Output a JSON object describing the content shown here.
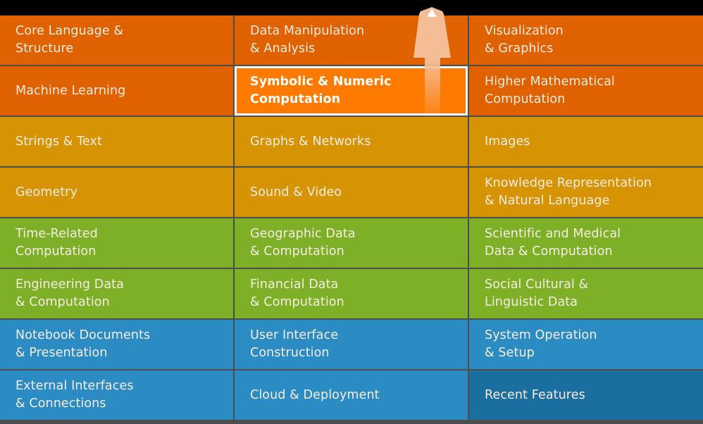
{
  "window": {
    "background_color": "#000000",
    "topbar_color": "#000000"
  },
  "palette": {
    "orange": "#df6100",
    "highlight_orange": "#ff7a00",
    "gold": "#d69405",
    "green": "#7db026",
    "blue": "#2b8cc4",
    "dark_blue": "#1b6ea0",
    "divider": "#4d4d4d",
    "label_text": "#f7ece3",
    "selected_text": "#ffffff",
    "selected_border": "#ffffff",
    "arrow": "#f5bd96"
  },
  "pointer": {
    "icon": "up-arrow-icon",
    "points_to": "Symbolic & Numeric Computation",
    "color": "#f5bd96"
  },
  "grid": {
    "columns": 3,
    "rows": 8,
    "cells": [
      {
        "label": "Core Language &\nStructure",
        "color": "orange",
        "selected": false
      },
      {
        "label": "Data Manipulation\n& Analysis",
        "color": "orange",
        "selected": false
      },
      {
        "label": "Visualization\n& Graphics",
        "color": "orange",
        "selected": false
      },
      {
        "label": "Machine Learning",
        "color": "orange",
        "selected": false
      },
      {
        "label": "Symbolic & Numeric\nComputation",
        "color": "orange",
        "selected": true
      },
      {
        "label": "Higher Mathematical\nComputation",
        "color": "orange",
        "selected": false
      },
      {
        "label": "Strings & Text",
        "color": "gold",
        "selected": false
      },
      {
        "label": "Graphs & Networks",
        "color": "gold",
        "selected": false
      },
      {
        "label": "Images",
        "color": "gold",
        "selected": false
      },
      {
        "label": "Geometry",
        "color": "gold",
        "selected": false
      },
      {
        "label": "Sound & Video",
        "color": "gold",
        "selected": false
      },
      {
        "label": "Knowledge Representation\n& Natural Language",
        "color": "gold",
        "selected": false
      },
      {
        "label": "Time-Related\nComputation",
        "color": "green",
        "selected": false
      },
      {
        "label": "Geographic Data\n& Computation",
        "color": "green",
        "selected": false
      },
      {
        "label": "Scientific and Medical\nData & Computation",
        "color": "green",
        "selected": false
      },
      {
        "label": "Engineering Data\n& Computation",
        "color": "green",
        "selected": false
      },
      {
        "label": "Financial Data\n& Computation",
        "color": "green",
        "selected": false
      },
      {
        "label": "Social Cultural &\nLinguistic Data",
        "color": "green",
        "selected": false
      },
      {
        "label": "Notebook Documents\n& Presentation",
        "color": "blue",
        "selected": false
      },
      {
        "label": "User Interface\nConstruction",
        "color": "blue",
        "selected": false
      },
      {
        "label": "System Operation\n& Setup",
        "color": "blue",
        "selected": false
      },
      {
        "label": "External Interfaces\n& Connections",
        "color": "blue",
        "selected": false
      },
      {
        "label": "Cloud & Deployment",
        "color": "blue",
        "selected": false
      },
      {
        "label": "Recent Features",
        "color": "dark_blue",
        "selected": false
      }
    ]
  }
}
